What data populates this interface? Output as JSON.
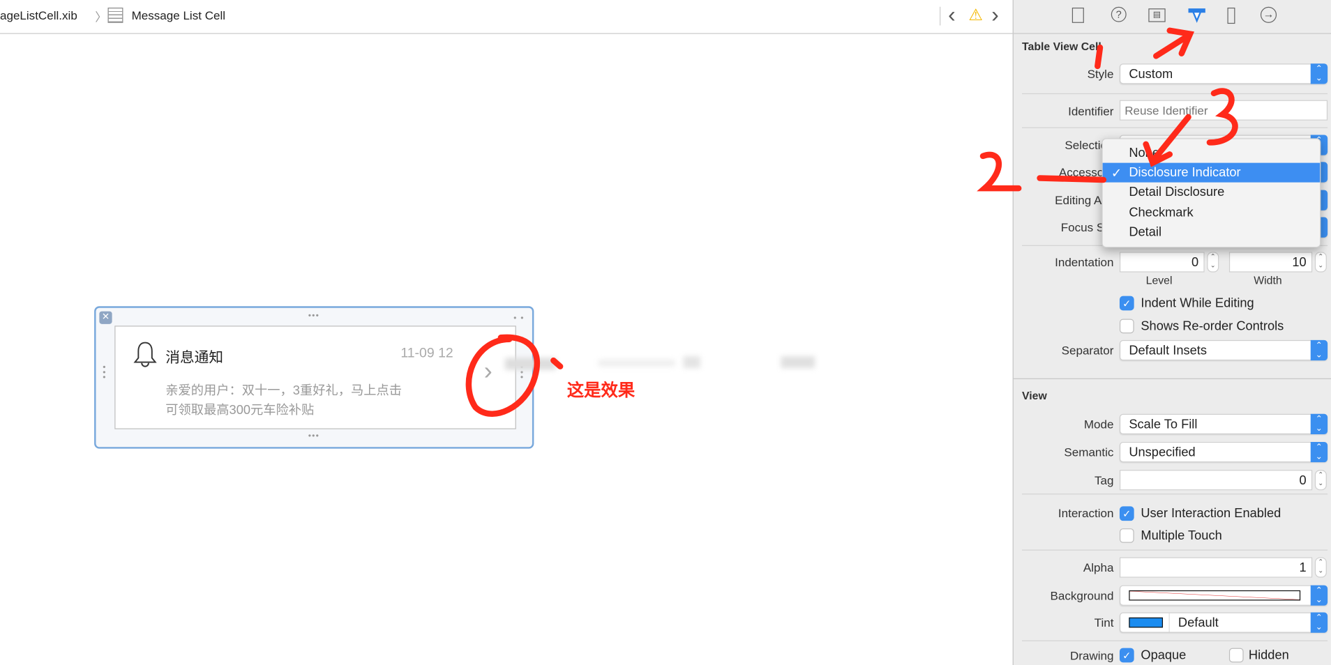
{
  "breadcrumb": {
    "file": "ageListCell.xib",
    "separator": "〉",
    "item": "Message List Cell"
  },
  "nav": {
    "back": "‹",
    "warning": "⚠",
    "forward": "›"
  },
  "inspector_tabs": [
    {
      "icon": "file-icon",
      "glyph": "🗋"
    },
    {
      "icon": "help-icon",
      "glyph": "?"
    },
    {
      "icon": "identity-icon",
      "glyph": "▤"
    },
    {
      "icon": "attributes-icon",
      "glyph": "⬇",
      "active": true
    },
    {
      "icon": "ruler-icon",
      "glyph": "▮"
    },
    {
      "icon": "connections-icon",
      "glyph": "→"
    }
  ],
  "table_view_cell": {
    "header": "Table View Cell",
    "style_label": "Style",
    "style_value": "Custom",
    "identifier_label": "Identifier",
    "identifier_placeholder": "Reuse Identifier",
    "selection_label": "Selection",
    "accessory_label": "Accessory",
    "editing_label": "Editing Acc",
    "focus_label": "Focus Sty",
    "indentation_label": "Indentation",
    "level_value": "0",
    "level_caption": "Level",
    "width_value": "10",
    "width_caption": "Width",
    "indent_while_editing": {
      "label": "Indent While Editing",
      "checked": true
    },
    "shows_reorder": {
      "label": "Shows Re-order Controls",
      "checked": false
    },
    "separator_label": "Separator",
    "separator_value": "Default Insets"
  },
  "accessory_menu": {
    "items": [
      "None",
      "Disclosure Indicator",
      "Detail Disclosure",
      "Checkmark",
      "Detail"
    ],
    "selected": "Disclosure Indicator",
    "check": "✓"
  },
  "view": {
    "header": "View",
    "mode_label": "Mode",
    "mode_value": "Scale To Fill",
    "semantic_label": "Semantic",
    "semantic_value": "Unspecified",
    "tag_label": "Tag",
    "tag_value": "0",
    "interaction_label": "Interaction",
    "user_interaction": {
      "label": "User Interaction Enabled",
      "checked": true
    },
    "multiple_touch": {
      "label": "Multiple Touch",
      "checked": false
    },
    "alpha_label": "Alpha",
    "alpha_value": "1",
    "background_label": "Background",
    "tint_label": "Tint",
    "tint_value": "Default",
    "tint_color": "#1a8cf0",
    "drawing_label": "Drawing",
    "opaque": {
      "label": "Opaque",
      "checked": true
    },
    "hidden": {
      "label": "Hidden",
      "checked": false
    }
  },
  "cell_preview": {
    "title": "消息通知",
    "date": "11-09 12",
    "body_line1": "亲爱的用户：双十一，3重好礼，马上点击",
    "body_line2": "可领取最高300元车险补贴",
    "accessory": "›"
  },
  "annotations": {
    "note": "这是效果",
    "marks": [
      "1",
      "2",
      "3"
    ],
    "color": "#ff2a1a"
  },
  "colors": {
    "accent": "#3b8ff0",
    "selection_frame": "#78a8dc"
  }
}
